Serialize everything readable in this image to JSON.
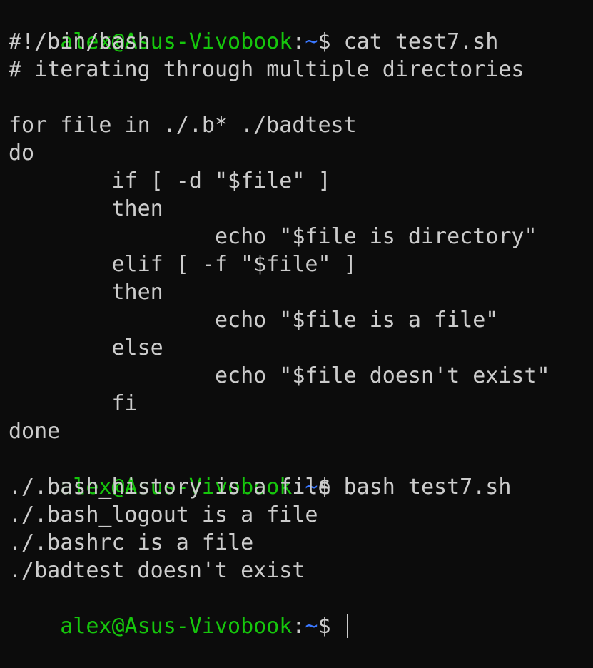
{
  "prompt": {
    "user_host": "alex@Asus-Vivobook",
    "colon": ":",
    "path": "~",
    "dollar": "$ "
  },
  "commands": {
    "cat": "cat test7.sh",
    "run": "bash test7.sh",
    "final": ""
  },
  "script_lines": [
    "#!/bin/bash",
    "# iterating through multiple directories",
    "",
    "for file in ./.b* ./badtest",
    "do",
    "        if [ -d \"$file\" ]",
    "        then",
    "                echo \"$file is directory\"",
    "        elif [ -f \"$file\" ]",
    "        then",
    "                echo \"$file is a file\"",
    "        else",
    "                echo \"$file doesn't exist\"",
    "        fi",
    "done"
  ],
  "output_lines": [
    "./.bash_history is a file",
    "./.bash_logout is a file",
    "./.bashrc is a file",
    "./badtest doesn't exist"
  ],
  "colors": {
    "background": "#0c0c0c",
    "text": "#cccccc",
    "prompt_user": "#16c60c",
    "prompt_path": "#3b78ff"
  }
}
